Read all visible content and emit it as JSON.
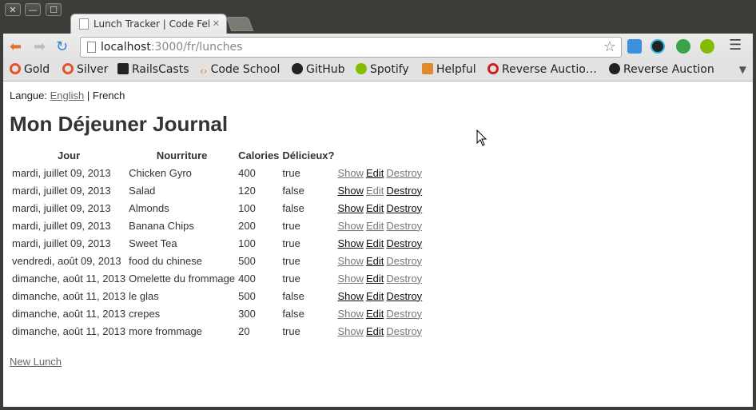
{
  "window": {
    "close": "✕",
    "minimize": "—",
    "maximize": "☐"
  },
  "tab": {
    "title": "Lunch Tracker | Code Fellows",
    "close": "✕"
  },
  "toolbar": {
    "url_host": "localhost",
    "url_path": ":3000/fr/lunches",
    "back_icon": "arrow-left-icon",
    "forward_icon": "arrow-right-icon",
    "reload_icon": "reload-icon"
  },
  "bookmarks": [
    {
      "label": "Gold",
      "color": "#e5532a"
    },
    {
      "label": "Silver",
      "color": "#e5532a"
    },
    {
      "label": "RailsCasts",
      "color": "#222222"
    },
    {
      "label": "Code School",
      "color": "#e07b2f"
    },
    {
      "label": "GitHub",
      "color": "#222222"
    },
    {
      "label": "Spotify",
      "color": "#84bd00"
    },
    {
      "label": "Helpful",
      "color": "#e08a2e"
    },
    {
      "label": "Reverse Auctio…",
      "color": "#cc2222"
    },
    {
      "label": "Reverse Auction",
      "color": "#222222"
    }
  ],
  "page": {
    "lang_label": "Langue:",
    "lang_english": "English",
    "lang_sep": "|",
    "lang_french": "French",
    "title": "Mon Déjeuner Journal",
    "headers": [
      "Jour",
      "Nourriture",
      "Calories",
      "Délicieux?"
    ],
    "rows": [
      {
        "day": "mardi, juillet 09, 2013",
        "food": "Chicken Gyro",
        "cal": "400",
        "tasty": "true"
      },
      {
        "day": "mardi, juillet 09, 2013",
        "food": "Salad",
        "cal": "120",
        "tasty": "false"
      },
      {
        "day": "mardi, juillet 09, 2013",
        "food": "Almonds",
        "cal": "100",
        "tasty": "false"
      },
      {
        "day": "mardi, juillet 09, 2013",
        "food": "Banana Chips",
        "cal": "200",
        "tasty": "true"
      },
      {
        "day": "mardi, juillet 09, 2013",
        "food": "Sweet Tea",
        "cal": "100",
        "tasty": "true"
      },
      {
        "day": "vendredi, août 09, 2013",
        "food": "food du chinese",
        "cal": "500",
        "tasty": "true"
      },
      {
        "day": "dimanche, août 11, 2013",
        "food": "Omelette du frommage",
        "cal": "400",
        "tasty": "true"
      },
      {
        "day": "dimanche, août 11, 2013",
        "food": "le glas",
        "cal": "500",
        "tasty": "false"
      },
      {
        "day": "dimanche, août 11, 2013",
        "food": "crepes",
        "cal": "300",
        "tasty": "false"
      },
      {
        "day": "dimanche, août 11, 2013",
        "food": "more frommage",
        "cal": "20",
        "tasty": "true"
      }
    ],
    "actions": {
      "show": "Show",
      "edit": "Edit",
      "destroy": "Destroy"
    },
    "new_lunch": "New Lunch"
  }
}
